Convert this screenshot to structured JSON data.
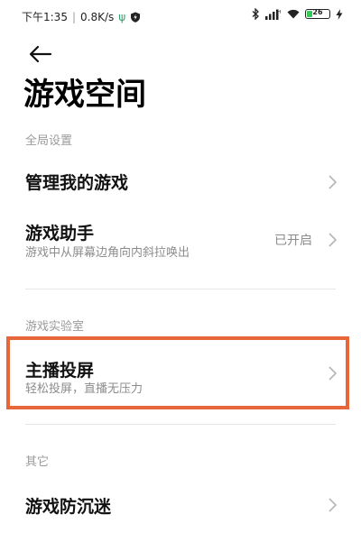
{
  "status_bar": {
    "time": "下午1:35",
    "separator": "|",
    "net_speed": "0.8K/s",
    "usb_icon": "usb-icon",
    "shield_icon": "shield-icon",
    "bluetooth_icon": "bluetooth-icon",
    "signal_icon": "signal-icon",
    "wifi_icon": "wifi-icon",
    "battery_level": "26",
    "battery_percent": 26,
    "charging_icon": "bolt-icon"
  },
  "nav": {
    "back_icon": "arrow-left-icon"
  },
  "page": {
    "title": "游戏空间"
  },
  "sections": {
    "global": {
      "header": "全局设置",
      "items": {
        "manage_games": {
          "title": "管理我的游戏"
        },
        "game_assistant": {
          "title": "游戏助手",
          "subtitle": "游戏中从屏幕边角向内斜拉唤出",
          "value": "已开启"
        }
      }
    },
    "lab": {
      "header": "游戏实验室",
      "items": {
        "streamer_cast": {
          "title": "主播投屏",
          "subtitle": "轻松投屏，直播无压力"
        }
      }
    },
    "other": {
      "header": "其它",
      "items": {
        "anti_addiction": {
          "title": "游戏防沉迷"
        }
      }
    }
  },
  "colors": {
    "highlight_border": "#e8673a",
    "battery_fill": "#34c759",
    "usb_green": "#2aa36b"
  }
}
